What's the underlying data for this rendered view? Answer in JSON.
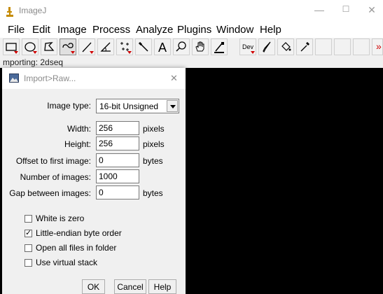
{
  "app": {
    "title": "ImageJ",
    "menu": [
      "File",
      "Edit",
      "Image",
      "Process",
      "Analyze",
      "Plugins",
      "Window",
      "Help"
    ],
    "status": "mporting: 2dseq",
    "window_controls": {
      "minimize": "—",
      "maximize": "☐",
      "close": "✕"
    },
    "toolbar": [
      {
        "name": "rectangle-tool-icon",
        "state": "normal"
      },
      {
        "name": "oval-tool-icon",
        "state": "normal"
      },
      {
        "name": "polygon-tool-icon",
        "state": "normal"
      },
      {
        "name": "freehand-tool-icon",
        "state": "active"
      },
      {
        "name": "line-tool-icon",
        "state": "normal"
      },
      {
        "name": "angle-tool-icon",
        "state": "normal"
      },
      {
        "name": "point-tool-icon",
        "state": "normal"
      },
      {
        "name": "wand-tool-icon",
        "state": "normal"
      },
      {
        "name": "text-tool-icon",
        "state": "normal",
        "glyph": "A"
      },
      {
        "name": "zoom-tool-icon",
        "state": "normal"
      },
      {
        "name": "hand-tool-icon",
        "state": "normal"
      },
      {
        "name": "color-picker-tool-icon",
        "state": "normal"
      },
      {
        "name": "dev-tool-icon",
        "state": "normal",
        "glyph": "Dev"
      },
      {
        "name": "brush-tool-icon",
        "state": "normal"
      },
      {
        "name": "flood-fill-tool-icon",
        "state": "normal"
      },
      {
        "name": "dropper-tool-icon",
        "state": "normal"
      },
      {
        "name": "empty-slot",
        "state": "empty"
      },
      {
        "name": "empty-slot",
        "state": "empty"
      },
      {
        "name": "empty-slot",
        "state": "empty"
      },
      {
        "name": "more-tools-icon",
        "state": "normal",
        "glyph": "»"
      }
    ]
  },
  "dialog": {
    "title": "Import>Raw...",
    "close": "✕",
    "image_type_label": "Image type:",
    "image_type_value": "16-bit Unsigned",
    "fields": [
      {
        "label": "Width:",
        "value": "256",
        "unit": "pixels"
      },
      {
        "label": "Height:",
        "value": "256",
        "unit": "pixels"
      },
      {
        "label": "Offset to first image:",
        "value": "0",
        "unit": "bytes"
      },
      {
        "label": "Number of images:",
        "value": "1000",
        "unit": ""
      },
      {
        "label": "Gap between images:",
        "value": "0",
        "unit": "bytes"
      }
    ],
    "checkboxes": [
      {
        "label": "White is zero",
        "checked": false
      },
      {
        "label": "Little-endian byte order",
        "checked": true
      },
      {
        "label": "Open all files in folder",
        "checked": false
      },
      {
        "label": "Use virtual stack",
        "checked": false
      }
    ],
    "check_glyph": "✓",
    "buttons": {
      "ok": "OK",
      "cancel": "Cancel",
      "help": "Help"
    }
  },
  "colors": {
    "canvas": "#000000",
    "window": "#f0f0f0",
    "tool_dropdown": "#d00000"
  }
}
